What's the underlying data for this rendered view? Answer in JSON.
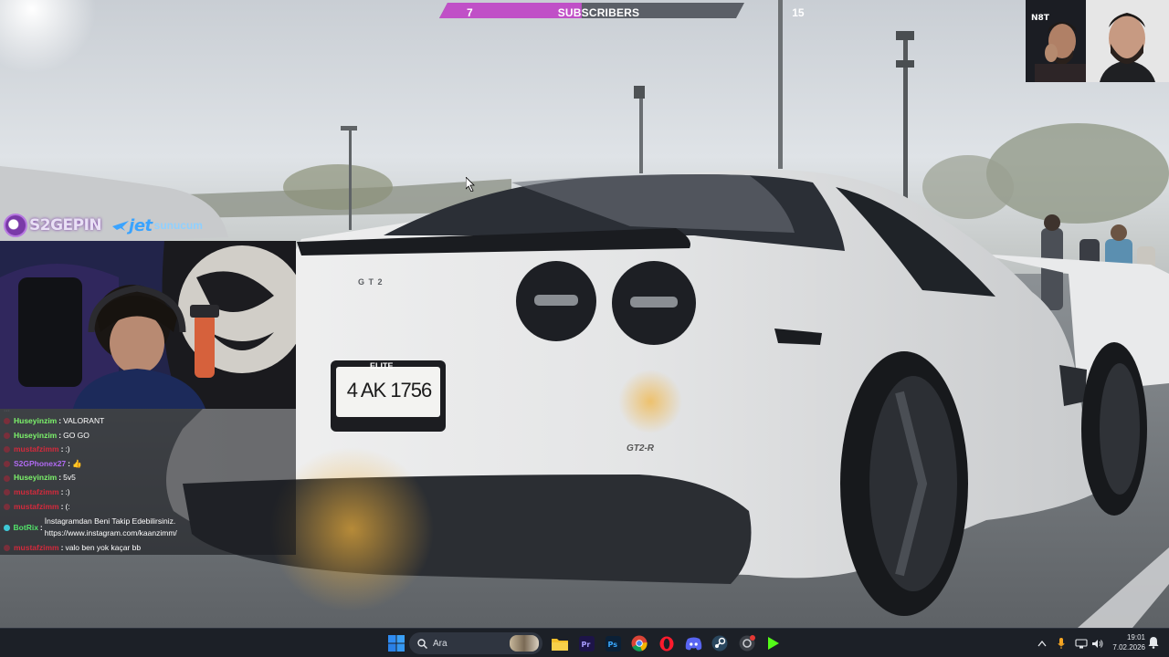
{
  "stream": {
    "subscribers_goal": {
      "current": "7",
      "title": "SUBSCRIBERS",
      "target": "15",
      "progress_fraction": 0.4667
    },
    "sponsors": {
      "brand_a": "S2GEPIN",
      "brand_b": "jet",
      "brand_b_suffix": "sunucum"
    },
    "plate": "4 AK 1756",
    "plate_top": "ELITE",
    "badge_left": "G T 2",
    "badge_right": "GT2-R"
  },
  "chat": {
    "messages": [
      {
        "user": "Huseyinzim",
        "color": "#7cf36b",
        "badge_color": "#7a2f3b",
        "text": "VALORANT"
      },
      {
        "user": "Huseyinzim",
        "color": "#7cf36b",
        "badge_color": "#7a2f3b",
        "text": "GO GO"
      },
      {
        "user": "mustafzimm",
        "color": "#d32a3c",
        "badge_color": "#7a2f3b",
        "text": ":)"
      },
      {
        "user": "S2GPhonex27",
        "color": "#b06af2",
        "badge_color": "#7a2f3b",
        "text": "👍"
      },
      {
        "user": "Huseyinzim",
        "color": "#7cf36b",
        "badge_color": "#7a2f3b",
        "text": "5v5"
      },
      {
        "user": "mustafzimm",
        "color": "#d32a3c",
        "badge_color": "#7a2f3b",
        "text": ":)"
      },
      {
        "user": "mustafzimm",
        "color": "#d32a3c",
        "badge_color": "#7a2f3b",
        "text": "(:"
      },
      {
        "user": "BotRix",
        "color": "#53e36a",
        "badge_color": "#3ec8d6",
        "text": "İnstagramdan Beni Takip Edebilirsiniz. https://www.instagram.com/kaanzimm/"
      },
      {
        "user": "mustafzimm",
        "color": "#d32a3c",
        "badge_color": "#7a2f3b",
        "text": "valo ben yok kaçar bb"
      }
    ]
  },
  "taskbar": {
    "search_placeholder": "Ara",
    "icons": [
      "windows-start-icon",
      "search-icon",
      "file-explorer-icon",
      "premiere-pro-icon",
      "photoshop-icon",
      "chrome-icon",
      "opera-icon",
      "discord-icon",
      "steam-icon",
      "chrome-badge-icon",
      "kick-icon"
    ],
    "time": "19:01",
    "date": "7.02.2026"
  },
  "colors": {
    "sub_fill": "#c050c7",
    "sub_track": "#5b5f67",
    "taskbar_bg": "#1c2027"
  }
}
